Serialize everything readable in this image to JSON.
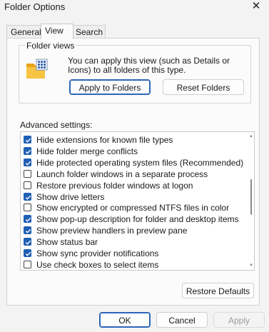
{
  "window": {
    "title": "Folder Options",
    "close_glyph": "✕"
  },
  "tabs": [
    {
      "label": "General",
      "active": false
    },
    {
      "label": "View",
      "active": true
    },
    {
      "label": "Search",
      "active": false
    }
  ],
  "folder_views": {
    "label": "Folder views",
    "icon": "folder-icon",
    "description": "You can apply this view (such as Details or Icons) to all folders of this type.",
    "apply_button": "Apply to Folders",
    "reset_button": "Reset Folders"
  },
  "advanced": {
    "label": "Advanced settings:",
    "items": [
      {
        "label": "Hide extensions for known file types",
        "checked": true
      },
      {
        "label": "Hide folder merge conflicts",
        "checked": true
      },
      {
        "label": "Hide protected operating system files (Recommended)",
        "checked": true
      },
      {
        "label": "Launch folder windows in a separate process",
        "checked": false
      },
      {
        "label": "Restore previous folder windows at logon",
        "checked": false
      },
      {
        "label": "Show drive letters",
        "checked": true
      },
      {
        "label": "Show encrypted or compressed NTFS files in color",
        "checked": false
      },
      {
        "label": "Show pop-up description for folder and desktop items",
        "checked": true
      },
      {
        "label": "Show preview handlers in preview pane",
        "checked": true
      },
      {
        "label": "Show status bar",
        "checked": true
      },
      {
        "label": "Show sync provider notifications",
        "checked": true
      },
      {
        "label": "Use check boxes to select items",
        "checked": false
      }
    ],
    "restore_button": "Restore Defaults"
  },
  "footer": {
    "ok": "OK",
    "cancel": "Cancel",
    "apply": "Apply"
  },
  "colors": {
    "accent": "#1f5fb5",
    "disabled_text": "#9a9a9a"
  }
}
